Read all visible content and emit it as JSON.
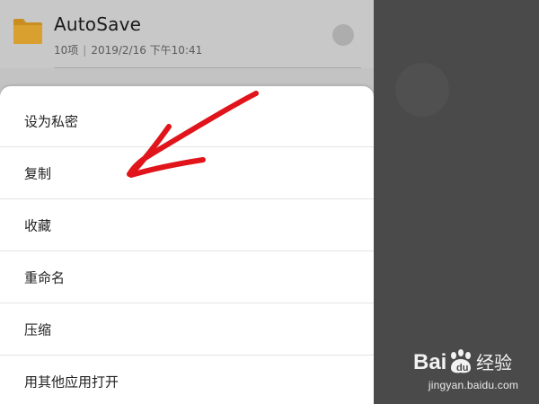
{
  "file": {
    "name": "AutoSave",
    "count": "10项",
    "separator": "|",
    "datetime": "2019/2/16 下午10:41",
    "icon": "folder-icon",
    "icon_color": "#d29a2a"
  },
  "menu": {
    "items": [
      {
        "label": "设为私密"
      },
      {
        "label": "复制"
      },
      {
        "label": "收藏"
      },
      {
        "label": "重命名"
      },
      {
        "label": "压缩"
      },
      {
        "label": "用其他应用打开"
      }
    ]
  },
  "annotation": {
    "arrow_color": "#e0141a",
    "points_to": "复制"
  },
  "watermark": {
    "logo_text": "Baidu经验",
    "url": "jingyan.baidu.com"
  }
}
